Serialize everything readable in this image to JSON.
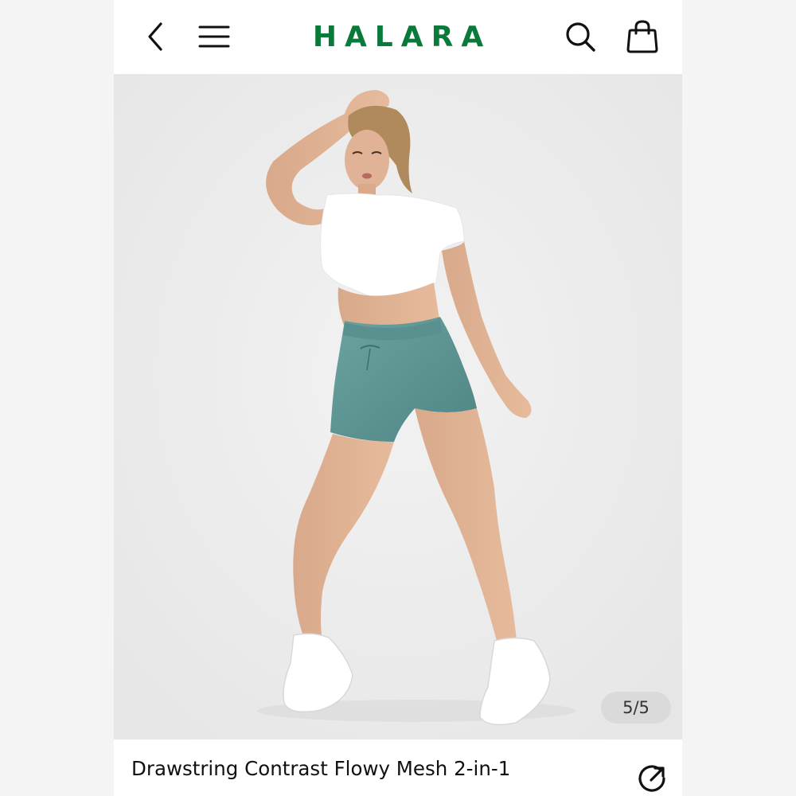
{
  "header": {
    "brand": "HALARA",
    "brand_color": "#0a7a3a",
    "back_icon": "chevron-left-icon",
    "menu_icon": "hamburger-menu-icon",
    "search_icon": "search-icon",
    "bag_icon": "shopping-bag-icon"
  },
  "gallery": {
    "image_description_icon": "model-photo",
    "counter": "5/5"
  },
  "product": {
    "title": "Drawstring Contrast Flowy Mesh 2-in-1",
    "share_icon": "share-icon"
  },
  "colors": {
    "shorts": "#5e9594",
    "top": "#ffffff",
    "background": "#ececec"
  }
}
